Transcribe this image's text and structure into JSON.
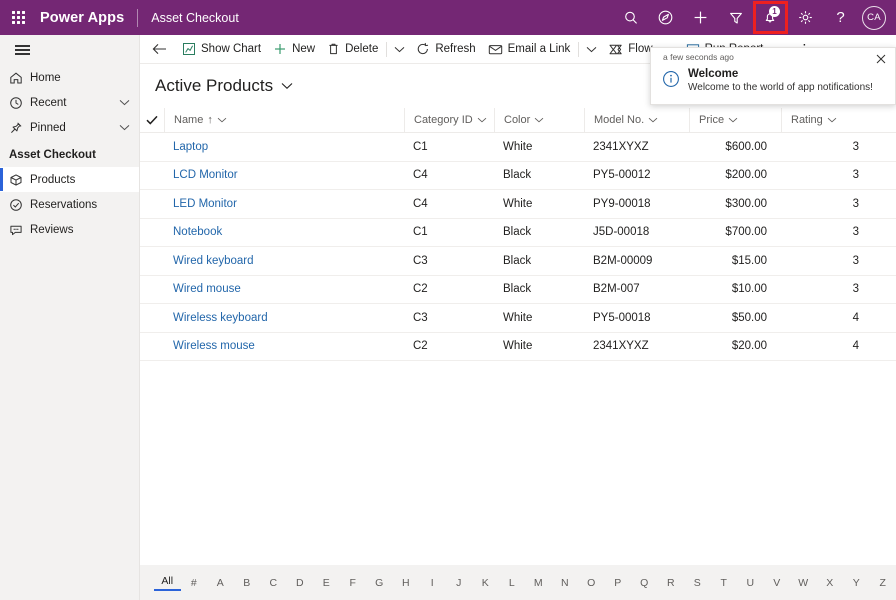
{
  "topbar": {
    "waffle_label": "app-launcher",
    "brand": "Power Apps",
    "app_name": "Asset Checkout",
    "purple": "#742774",
    "icons": [
      "search-icon",
      "assistant-icon",
      "plus-icon",
      "filter-icon",
      "bell-icon",
      "gear-icon",
      "help-icon"
    ],
    "notification_count": "1",
    "highlight_color": "#ee2020",
    "avatar_initials": "CA"
  },
  "sidebar": {
    "hamburger_label": "site-map-toggle",
    "items": [
      {
        "label": "Home",
        "icon": "home-icon",
        "chevron": false
      },
      {
        "label": "Recent",
        "icon": "clock-icon",
        "chevron": true
      },
      {
        "label": "Pinned",
        "icon": "pin-icon",
        "chevron": true
      }
    ],
    "group_title": "Asset Checkout",
    "group_items": [
      {
        "label": "Products",
        "icon": "box-icon",
        "selected": true
      },
      {
        "label": "Reservations",
        "icon": "check-circle-icon",
        "selected": false
      },
      {
        "label": "Reviews",
        "icon": "comment-icon",
        "selected": false
      }
    ],
    "selected_accent": "#2b63d9"
  },
  "commandbar": {
    "back_label": "back-arrow",
    "buttons": [
      {
        "label": "Show Chart",
        "icon": "chart-icon"
      },
      {
        "label": "New",
        "icon": "plus-icon"
      },
      {
        "label": "Delete",
        "icon": "trash-icon"
      },
      {
        "label": "Refresh",
        "icon": "refresh-icon"
      },
      {
        "label": "Email a Link",
        "icon": "email-link-icon"
      },
      {
        "label": "Flow",
        "icon": "flow-icon"
      },
      {
        "label": "Run Report",
        "icon": "report-icon"
      }
    ],
    "overflow_label": "more-commands"
  },
  "notification": {
    "time": "a few seconds ago",
    "title": "Welcome",
    "message": "Welcome to the world of app notifications!",
    "icon": "info-icon",
    "close_label": "close-notification"
  },
  "view": {
    "title": "Active Products",
    "chevron": "chevron-down-icon"
  },
  "grid": {
    "columns": [
      {
        "key": "name",
        "label": "Name",
        "sorted": true,
        "sort_arrow": "↑"
      },
      {
        "key": "cat",
        "label": "Category ID",
        "sorted": false
      },
      {
        "key": "color",
        "label": "Color",
        "sorted": false
      },
      {
        "key": "model",
        "label": "Model No.",
        "sorted": false
      },
      {
        "key": "price",
        "label": "Price",
        "sorted": false
      },
      {
        "key": "rating",
        "label": "Rating",
        "sorted": false
      }
    ],
    "rows": [
      {
        "name": "Laptop",
        "cat": "C1",
        "color": "White",
        "model": "2341XYXZ",
        "price": "$600.00",
        "rating": "3"
      },
      {
        "name": "LCD Monitor",
        "cat": "C4",
        "color": "Black",
        "model": "PY5-00012",
        "price": "$200.00",
        "rating": "3"
      },
      {
        "name": "LED Monitor",
        "cat": "C4",
        "color": "White",
        "model": "PY9-00018",
        "price": "$300.00",
        "rating": "3"
      },
      {
        "name": "Notebook",
        "cat": "C1",
        "color": "Black",
        "model": "J5D-00018",
        "price": "$700.00",
        "rating": "3"
      },
      {
        "name": "Wired keyboard",
        "cat": "C3",
        "color": "Black",
        "model": "B2M-00009",
        "price": "$15.00",
        "rating": "3"
      },
      {
        "name": "Wired mouse",
        "cat": "C2",
        "color": "Black",
        "model": "B2M-007",
        "price": "$10.00",
        "rating": "3"
      },
      {
        "name": "Wireless keyboard",
        "cat": "C3",
        "color": "White",
        "model": "PY5-00018",
        "price": "$50.00",
        "rating": "4"
      },
      {
        "name": "Wireless mouse",
        "cat": "C2",
        "color": "White",
        "model": "2341XYXZ",
        "price": "$20.00",
        "rating": "4"
      }
    ],
    "link_color": "#2266aa"
  },
  "alphabar": {
    "items": [
      "All",
      "#",
      "A",
      "B",
      "C",
      "D",
      "E",
      "F",
      "G",
      "H",
      "I",
      "J",
      "K",
      "L",
      "M",
      "N",
      "O",
      "P",
      "Q",
      "R",
      "S",
      "T",
      "U",
      "V",
      "W",
      "X",
      "Y",
      "Z"
    ],
    "active": "All"
  }
}
